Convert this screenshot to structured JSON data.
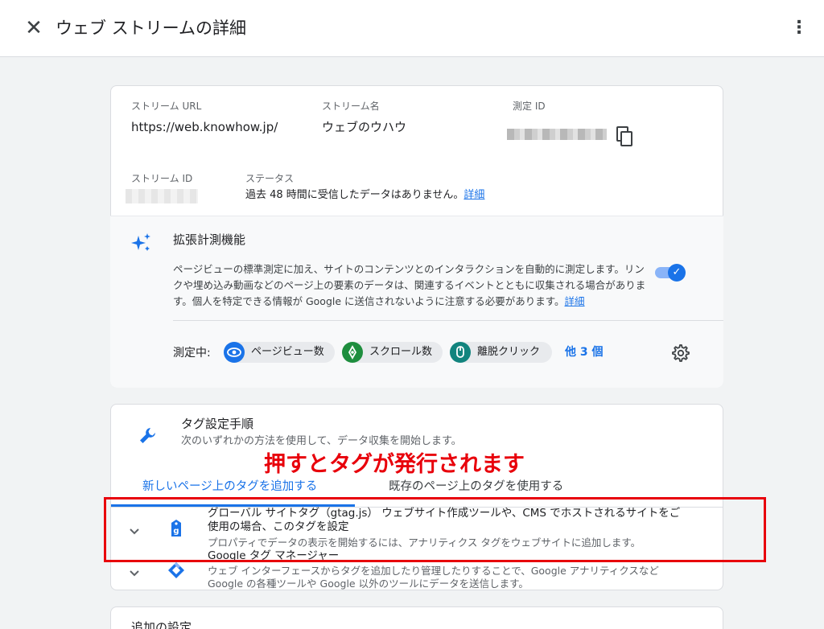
{
  "header": {
    "title": "ウェブ ストリームの詳細"
  },
  "stream": {
    "url_label": "ストリーム URL",
    "url_value": "https://web.knowhow.jp/",
    "name_label": "ストリーム名",
    "name_value": "ウェブのウハウ",
    "measurement_id_label": "測定 ID",
    "stream_id_label": "ストリーム ID",
    "status_label": "ステータス",
    "status_value": "過去 48 時間に受信したデータはありません。",
    "status_link": "詳細"
  },
  "enhanced": {
    "title": "拡張計測機能",
    "description": "ページビューの標準測定に加え、サイトのコンテンツとのインタラクションを自動的に測定します。リンクや埋め込み動画などのページ上の要素のデータは、関連するイベントとともに収集される場合があります。個人を特定できる情報が Google に送信されないように注意する必要があります。",
    "description_link": "詳細",
    "enabled": true,
    "measuring_label": "測定中:",
    "chips": [
      {
        "label": "ページビュー数",
        "icon": "eye-icon",
        "color": "#1a73e8"
      },
      {
        "label": "スクロール数",
        "icon": "scroll-icon",
        "color": "#1e8e3e"
      },
      {
        "label": "離脱クリック",
        "icon": "mouse-icon",
        "color": "#12847e"
      }
    ],
    "more_link": "他 3 個"
  },
  "tagging": {
    "title": "タグ設定手順",
    "subtitle": "次のいずれかの方法を使用して、データ収集を開始します。",
    "tabs": [
      {
        "label": "新しいページ上のタグを追加する",
        "active": true
      },
      {
        "label": "既存のページ上のタグを使用する",
        "active": false
      }
    ],
    "options": [
      {
        "title": "グローバル サイトタグ（gtag.js） ウェブサイト作成ツールや、CMS でホストされるサイトをご使用の場合、このタグを設定",
        "description": "プロパティでデータの表示を開始するには、アナリティクス タグをウェブサイトに追加します。",
        "icon": "gtag-icon"
      },
      {
        "title": "Google タグ マネージャー",
        "description": "ウェブ インターフェースからタグを追加したり管理したりすることで、Google アナリティクスなど Google の各種ツールや Google 以外のツールにデータを送信します。",
        "icon": "tag-manager-icon"
      }
    ]
  },
  "additional": {
    "title": "追加の設定"
  },
  "annotation": {
    "text": "押すとタグが発行されます",
    "color": "#e8000b"
  },
  "colors": {
    "accent": "#1a73e8",
    "background": "#f1f3f4"
  }
}
